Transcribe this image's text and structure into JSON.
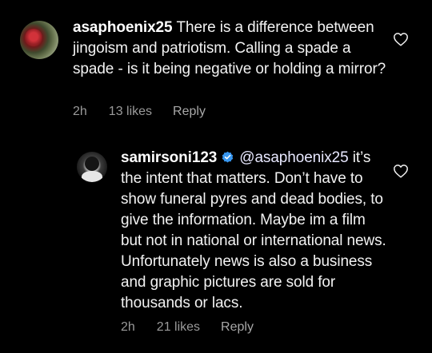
{
  "comments": [
    {
      "username": "asaphoenix25",
      "verified": false,
      "text": "There is a difference between jingoism and patriotism. Calling a spade a spade - is it being negative or holding a mirror?",
      "time": "2h",
      "likes": "13 likes",
      "reply_label": "Reply"
    },
    {
      "username": "samirsoni123",
      "verified": true,
      "mention": "@asaphoenix25",
      "text": " it’s the intent that matters. Don’t have to show funeral pyres  and dead bodies, to give the information. Maybe im a film but not in national or international news. Unfortunately news is also a business and graphic pictures are sold for thousands or lacs.",
      "time": "2h",
      "likes": "21 likes",
      "reply_label": "Reply"
    }
  ],
  "colors": {
    "background": "#000000",
    "text": "#f2f2f2",
    "meta": "#9a9a9a",
    "verified": "#3897f0"
  },
  "icons": {
    "like": "heart-outline-icon",
    "verified": "verified-badge-icon"
  }
}
